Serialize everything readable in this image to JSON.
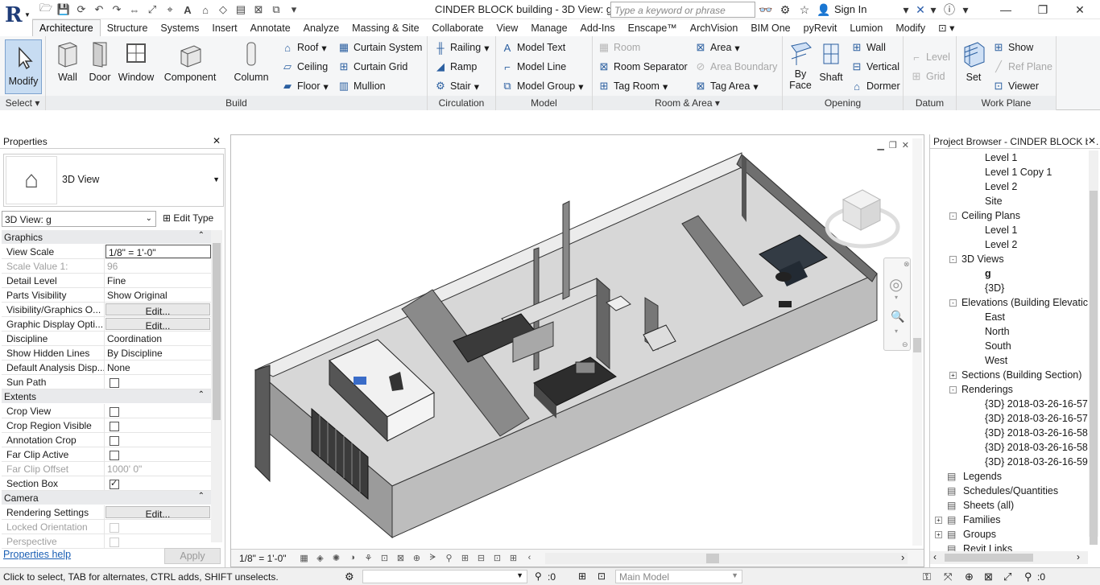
{
  "titlebar": {
    "doc_title": "CINDER BLOCK building - 3D View: g",
    "search_placeholder": "Type a keyword or phrase",
    "sign_in": "Sign In"
  },
  "tabs": [
    "Architecture",
    "Structure",
    "Systems",
    "Insert",
    "Annotate",
    "Analyze",
    "Massing & Site",
    "Collaborate",
    "View",
    "Manage",
    "Add-Ins",
    "Enscape™",
    "ArchVision",
    "BIM One",
    "pyRevit",
    "Lumion",
    "Modify"
  ],
  "ribbon": {
    "select": {
      "button": "Modify",
      "label": "Select"
    },
    "build": {
      "label": "Build",
      "big": [
        "Wall",
        "Door",
        "Window",
        "Component",
        "Column"
      ],
      "small": [
        "Roof",
        "Ceiling",
        "Floor",
        "Curtain System",
        "Curtain Grid",
        "Mullion"
      ]
    },
    "circulation": {
      "label": "Circulation",
      "items": [
        "Railing",
        "Ramp",
        "Stair"
      ]
    },
    "model": {
      "label": "Model",
      "items": [
        "Model Text",
        "Model Line",
        "Model Group"
      ]
    },
    "room_area": {
      "label": "Room & Area",
      "items": [
        "Room",
        "Room Separator",
        "Tag Room",
        "Area",
        "Area Boundary",
        "Tag Area"
      ]
    },
    "opening": {
      "label": "Opening",
      "by_face": "By",
      "by_face2": "Face",
      "shaft": "Shaft",
      "items": [
        "Wall",
        "Vertical",
        "Dormer"
      ]
    },
    "datum": {
      "label": "Datum",
      "items": [
        "Level",
        "Grid"
      ]
    },
    "work_plane": {
      "label": "Work Plane",
      "set": "Set",
      "items": [
        "Show",
        "Ref Plane",
        "Viewer"
      ]
    }
  },
  "properties": {
    "title": "Properties",
    "type_name": "3D View",
    "instance": "3D View: g",
    "edit_type": "Edit Type",
    "groups": [
      {
        "name": "Graphics",
        "rows": [
          {
            "k": "View Scale",
            "v": "1/8\" = 1'-0\"",
            "kind": "input"
          },
          {
            "k": "Scale Value    1:",
            "v": "96",
            "kind": "dim"
          },
          {
            "k": "Detail Level",
            "v": "Fine"
          },
          {
            "k": "Parts Visibility",
            "v": "Show Original"
          },
          {
            "k": "Visibility/Graphics O...",
            "v": "Edit...",
            "kind": "btn"
          },
          {
            "k": "Graphic Display Opti...",
            "v": "Edit...",
            "kind": "btn"
          },
          {
            "k": "Discipline",
            "v": "Coordination"
          },
          {
            "k": "Show Hidden Lines",
            "v": "By Discipline"
          },
          {
            "k": "Default Analysis Disp...",
            "v": "None"
          },
          {
            "k": "Sun Path",
            "v": "",
            "kind": "chk"
          }
        ]
      },
      {
        "name": "Extents",
        "rows": [
          {
            "k": "Crop View",
            "v": "",
            "kind": "chk"
          },
          {
            "k": "Crop Region Visible",
            "v": "",
            "kind": "chk"
          },
          {
            "k": "Annotation Crop",
            "v": "",
            "kind": "chk"
          },
          {
            "k": "Far Clip Active",
            "v": "",
            "kind": "chk"
          },
          {
            "k": "Far Clip Offset",
            "v": "1000'  0\"",
            "kind": "dim"
          },
          {
            "k": "Section Box",
            "v": "",
            "kind": "chkon"
          }
        ]
      },
      {
        "name": "Camera",
        "rows": [
          {
            "k": "Rendering Settings",
            "v": "Edit...",
            "kind": "btn"
          },
          {
            "k": "Locked Orientation",
            "v": "",
            "kind": "chkdim"
          },
          {
            "k": "Perspective",
            "v": "",
            "kind": "chkdim"
          }
        ]
      }
    ],
    "help": "Properties help",
    "apply": "Apply"
  },
  "viewport": {
    "scale": "1/8\" = 1'-0\""
  },
  "project_browser": {
    "title": "Project Browser - CINDER BLOCK b...",
    "tree": [
      {
        "t": "Level 1",
        "d": 3
      },
      {
        "t": "Level 1 Copy 1",
        "d": 3
      },
      {
        "t": "Level 2",
        "d": 3
      },
      {
        "t": "Site",
        "d": 3
      },
      {
        "t": "Ceiling Plans",
        "d": 2,
        "tog": "-"
      },
      {
        "t": "Level 1",
        "d": 3
      },
      {
        "t": "Level 2",
        "d": 3
      },
      {
        "t": "3D Views",
        "d": 2,
        "tog": "-"
      },
      {
        "t": "g",
        "d": 3,
        "bold": true
      },
      {
        "t": "{3D}",
        "d": 3
      },
      {
        "t": "Elevations (Building Elevatic",
        "d": 2,
        "tog": "-"
      },
      {
        "t": "East",
        "d": 3
      },
      {
        "t": "North",
        "d": 3
      },
      {
        "t": "South",
        "d": 3
      },
      {
        "t": "West",
        "d": 3
      },
      {
        "t": "Sections (Building Section)",
        "d": 2,
        "tog": "+"
      },
      {
        "t": "Renderings",
        "d": 2,
        "tog": "-"
      },
      {
        "t": "{3D} 2018-03-26-16-57",
        "d": 3
      },
      {
        "t": "{3D} 2018-03-26-16-57",
        "d": 3
      },
      {
        "t": "{3D} 2018-03-26-16-58",
        "d": 3
      },
      {
        "t": "{3D} 2018-03-26-16-58",
        "d": 3
      },
      {
        "t": "{3D} 2018-03-26-16-59",
        "d": 3
      },
      {
        "t": "Legends",
        "d": 1,
        "icon": true
      },
      {
        "t": "Schedules/Quantities",
        "d": 1,
        "icon": true
      },
      {
        "t": "Sheets (all)",
        "d": 1,
        "icon": true
      },
      {
        "t": "Families",
        "d": 1,
        "tog": "+",
        "icon": true
      },
      {
        "t": "Groups",
        "d": 1,
        "tog": "+",
        "icon": true
      },
      {
        "t": "Revit Links",
        "d": 1,
        "icon": true
      }
    ]
  },
  "status": {
    "text": "Click to select, TAB for alternates, CTRL adds, SHIFT unselects.",
    "count": ":0",
    "model": "Main Model",
    "filter": ":0"
  }
}
